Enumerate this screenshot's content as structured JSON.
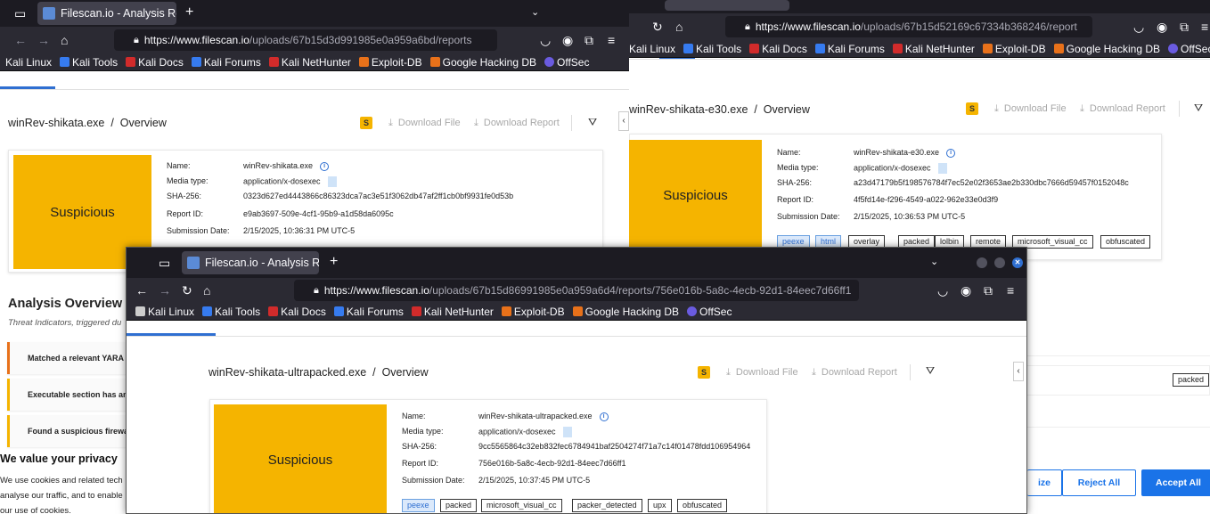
{
  "browser": {
    "bookmarks": [
      {
        "label": "Kali Linux",
        "color": "#367bf0"
      },
      {
        "label": "Kali Tools",
        "color": "#367bf0"
      },
      {
        "label": "Kali Docs",
        "color": "#d12b2b"
      },
      {
        "label": "Kali Forums",
        "color": "#367bf0"
      },
      {
        "label": "Kali NetHunter",
        "color": "#d12b2b"
      },
      {
        "label": "Exploit-DB",
        "color": "#e8711a"
      },
      {
        "label": "Google Hacking DB",
        "color": "#e8711a"
      },
      {
        "label": "OffSec",
        "color": "#6a5be0"
      }
    ]
  },
  "left_window": {
    "tab_title": "Filescan.io - Analysis Repo",
    "url_host": "https://www.filescan.io",
    "url_path": "/uploads/67b15d3d991985e0a959a6bd/reports",
    "breadcrumb_file": "winRev-shikata.exe",
    "breadcrumb_sep": "/",
    "breadcrumb_page": "Overview",
    "badge": "S",
    "download_file": "Download File",
    "download_report": "Download Report",
    "verdict": "Suspicious",
    "details": {
      "name_label": "Name:",
      "name": "winRev-shikata.exe",
      "media_label": "Media type:",
      "media": "application/x-dosexec",
      "sha_label": "SHA-256:",
      "sha": "0323d627ed4443866c86323dca7ac3e51f3062db47af2ff1cb0bf9931fe0d53b",
      "report_label": "Report ID:",
      "report": "e9ab3697-509e-4cf1-95b9-a1d58da6095c",
      "date_label": "Submission Date:",
      "date": "2/15/2025, 10:36:31 PM UTC-5"
    },
    "analysis_title": "Analysis Overview",
    "analysis_sub": "Threat Indicators, triggered du",
    "indicators": [
      {
        "text": "Matched a relevant YARA r",
        "color": "orange"
      },
      {
        "text": "Executable section has an",
        "color": "yellow"
      },
      {
        "text": "Found a suspicious firewal",
        "color": "yellow"
      }
    ],
    "privacy": {
      "title": "We value your privacy",
      "line1": "We use cookies and related tech",
      "line2": "analyse our traffic, and to enable",
      "line3": "our use of cookies."
    }
  },
  "right_window": {
    "url_host": "https://www.filescan.io",
    "url_path": "/uploads/67b15d52169c67334b368246/report",
    "breadcrumb_file": "winRev-shikata-e30.exe",
    "breadcrumb_sep": "/",
    "breadcrumb_page": "Overview",
    "badge": "S",
    "download_file": "Download File",
    "download_report": "Download Report",
    "verdict": "Suspicious",
    "details": {
      "name_label": "Name:",
      "name": "winRev-shikata-e30.exe",
      "media_label": "Media type:",
      "media": "application/x-dosexec",
      "sha_label": "SHA-256:",
      "sha": "a23d47179b5f198576784f7ec52e02f3653ae2b330dbc7666d59457f0152048c",
      "report_label": "Report ID:",
      "report": "4f5fd14e-f296-4549-a022-962e33e0d3f9",
      "date_label": "Submission Date:",
      "date": "2/15/2025, 10:36:53 PM UTC-5"
    },
    "tags": [
      {
        "label": "peexe",
        "blue": true
      },
      {
        "label": "html",
        "blue": true
      },
      {
        "label": "overlay",
        "blue": false
      },
      {
        "label": "packed",
        "blue": false
      },
      {
        "label": "lolbin",
        "blue": false
      },
      {
        "label": "remote",
        "blue": false
      },
      {
        "label": "microsoft_visual_cc",
        "blue": false
      },
      {
        "label": "obfuscated",
        "blue": false
      }
    ],
    "side_tag": "packed",
    "cookie_buttons": {
      "customize": "ize",
      "reject": "Reject All",
      "accept": "Accept All"
    }
  },
  "front_window": {
    "tab_title": "Filescan.io - Analysis Repo",
    "url_host": "https://www.filescan.io",
    "url_path": "/uploads/67b15d86991985e0a959a6d4/reports/756e016b-5a8c-4ecb-92d1-84eec7d66ff1",
    "breadcrumb_file": "winRev-shikata-ultrapacked.exe",
    "breadcrumb_sep": "/",
    "breadcrumb_page": "Overview",
    "badge": "S",
    "download_file": "Download File",
    "download_report": "Download Report",
    "verdict": "Suspicious",
    "details": {
      "name_label": "Name:",
      "name": "winRev-shikata-ultrapacked.exe",
      "media_label": "Media type:",
      "media": "application/x-dosexec",
      "sha_label": "SHA-256:",
      "sha": "9cc5565864c32eb832fec6784941baf2504274f71a7c14f01478fdd106954964",
      "report_label": "Report ID:",
      "report": "756e016b-5a8c-4ecb-92d1-84eec7d66ff1",
      "date_label": "Submission Date:",
      "date": "2/15/2025, 10:37:45 PM UTC-5"
    },
    "tags": [
      {
        "label": "peexe",
        "blue": true
      },
      {
        "label": "packed",
        "blue": false
      },
      {
        "label": "microsoft_visual_cc",
        "blue": false
      },
      {
        "label": "packer_detected",
        "blue": false
      },
      {
        "label": "upx",
        "blue": false
      },
      {
        "label": "obfuscated",
        "blue": false
      }
    ]
  }
}
